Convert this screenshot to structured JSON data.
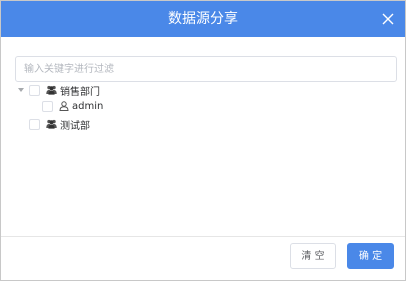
{
  "dialog": {
    "title": "数据源分享",
    "header_color": "#4a88e8"
  },
  "search": {
    "placeholder": "输入关键字进行过滤",
    "value": ""
  },
  "tree": {
    "nodes": [
      {
        "label": "销售部门",
        "icon": "group-icon",
        "expanded": true,
        "checked": false
      },
      {
        "label": "admin",
        "icon": "user-icon",
        "checked": false
      },
      {
        "label": "测试部",
        "icon": "group-icon",
        "expanded": false,
        "checked": false
      }
    ]
  },
  "footer": {
    "clear_label": "清 空",
    "confirm_label": "确 定"
  }
}
